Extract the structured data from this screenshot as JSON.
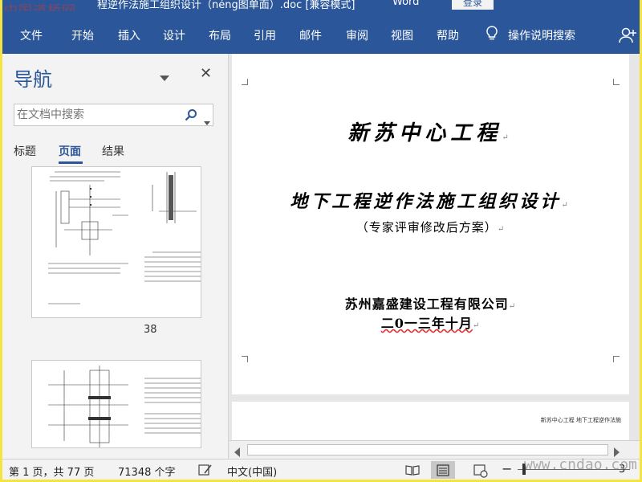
{
  "window": {
    "title": "程逆作法施工组织设计（néng图单面）.doc [兼容模式]",
    "app_name": "Word",
    "login_button": "登录",
    "watermark_logo": "中国道桥网"
  },
  "ribbon": {
    "tabs": [
      "文件",
      "开始",
      "插入",
      "设计",
      "布局",
      "引用",
      "邮件",
      "审阅",
      "视图",
      "帮助"
    ],
    "tell_me": "操作说明搜索"
  },
  "nav_pane": {
    "title": "导航",
    "search_placeholder": "在文档中搜索",
    "tabs": [
      "标题",
      "页面",
      "结果"
    ],
    "active_tab": "页面",
    "thumbnail_page_number": "38"
  },
  "document": {
    "line1": "新苏中心工程",
    "line2": "地下工程逆作法施工组织设计",
    "line3": "（专家评审修改后方案）",
    "line4": "苏州嘉盛建设工程有限公司",
    "line5": "二0一三年十月",
    "page2_header": "新苏中心工程    地下工程逆作法施"
  },
  "status_bar": {
    "page_info": "第 1 页，共 77 页",
    "word_count": "71348 个字",
    "language": "中文(中国)",
    "zoom_end": "3"
  },
  "site_watermark": "www.cndao.com",
  "colors": {
    "word_blue": "#2b579a",
    "frame_yellow": "#f5e342"
  }
}
